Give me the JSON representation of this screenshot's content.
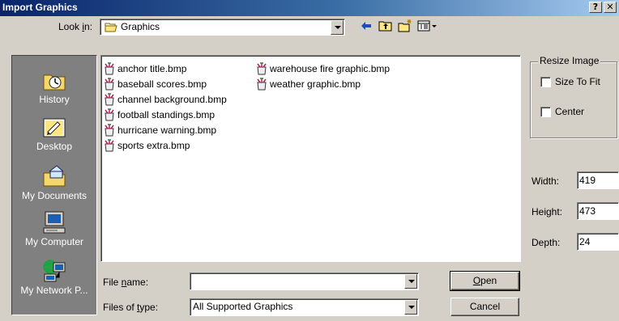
{
  "window": {
    "title": "Import Graphics",
    "help_glyph": "?",
    "close_glyph": "✕"
  },
  "look_in": {
    "label_prefix": "Look ",
    "label_accel": "i",
    "label_suffix": "n:",
    "value": "Graphics",
    "icon": "folder-icon"
  },
  "toolbar": {
    "back_icon": "back-arrow-icon",
    "up_icon": "up-folder-icon",
    "new_folder_icon": "new-folder-icon",
    "view_menu_icon": "view-menu-icon"
  },
  "places": [
    {
      "label": "History",
      "icon": "history-icon"
    },
    {
      "label": "Desktop",
      "icon": "desktop-icon"
    },
    {
      "label": "My Documents",
      "icon": "my-documents-icon"
    },
    {
      "label": "My Computer",
      "icon": "my-computer-icon"
    },
    {
      "label": "My Network P...",
      "icon": "my-network-places-icon"
    }
  ],
  "files": [
    {
      "name": "anchor title.bmp"
    },
    {
      "name": "baseball scores.bmp"
    },
    {
      "name": "channel background.bmp"
    },
    {
      "name": "football standings.bmp"
    },
    {
      "name": "hurricane warning.bmp"
    },
    {
      "name": "sports extra.bmp"
    },
    {
      "name": "warehouse fire graphic.bmp"
    },
    {
      "name": "weather graphic.bmp"
    }
  ],
  "file_name": {
    "label_prefix": "File ",
    "label_accel": "n",
    "label_suffix": "ame:",
    "value": ""
  },
  "files_of_type": {
    "label_prefix": "Files of ",
    "label_accel": "t",
    "label_suffix": "ype:",
    "value": "All Supported Graphics"
  },
  "buttons": {
    "open_accel": "O",
    "open_rest": "pen",
    "cancel": "Cancel"
  },
  "resize": {
    "group_title": "Resize Image",
    "size_to_fit": "Size To Fit",
    "size_to_fit_checked": false,
    "center": "Center",
    "center_checked": false
  },
  "dims": {
    "width_label": "Width:",
    "width_value": "419",
    "height_label": "Height:",
    "height_value": "473",
    "depth_label": "Depth:",
    "depth_value": "24"
  },
  "colors": {
    "title_start": "#0a246a",
    "title_end": "#a6caf0",
    "face": "#d4d0c8",
    "places_bg": "#808080"
  }
}
